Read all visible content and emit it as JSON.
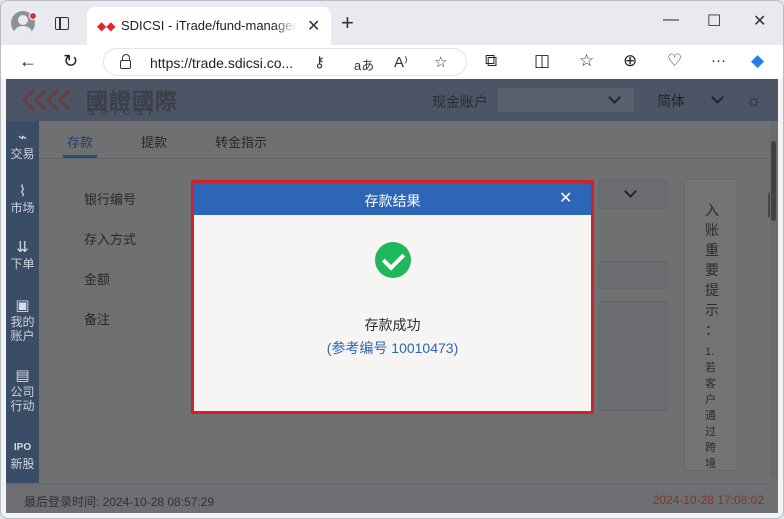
{
  "browser": {
    "tab_title": "SDICSI - iTrade/fund-management",
    "url": "https://trade.sdicsi.co...",
    "new_tab_glyph": "+",
    "close_glyph": "✕",
    "minimize_glyph": "—",
    "maximize_glyph": "☐",
    "window_close_glyph": "✕",
    "back_glyph": "←",
    "refresh_glyph": "↻",
    "more_glyph": "···"
  },
  "app": {
    "logo_cn": "國證國際",
    "logo_en": "SDICSI",
    "account_label": "现金账户",
    "account_value": "",
    "language": "简体",
    "sidebar": [
      {
        "icon": "trade-icon",
        "glyph": "⌁",
        "label": "交易"
      },
      {
        "icon": "market-icon",
        "glyph": "📈",
        "label": "市场"
      },
      {
        "icon": "order-icon",
        "glyph": "⇊",
        "label": "下单"
      },
      {
        "icon": "wallet-icon",
        "glyph": "▣",
        "label": "我的账户"
      },
      {
        "icon": "building-icon",
        "glyph": "▤",
        "label": "公司行动"
      },
      {
        "icon": "ipo-icon",
        "glyph": "IPO",
        "label": "新股"
      }
    ],
    "tabs": [
      "存款",
      "提款",
      "转金指示"
    ],
    "form": {
      "bank_code_label": "银行编号",
      "deposit_method_label": "存入方式",
      "amount_label": "金额",
      "remark_label": "备注"
    },
    "notice": {
      "title_chars": [
        "入",
        "账",
        "重",
        "要",
        "提",
        "示",
        "："
      ],
      "body_chars": [
        "1.",
        "若",
        "客",
        "户",
        "通",
        "过",
        "跨",
        "境"
      ]
    },
    "footer": {
      "last_login": "最后登录时间: 2024-10-28 08:57:29",
      "clock": "2024-10-28 17:08:02"
    }
  },
  "modal": {
    "title": "存款结果",
    "close": "✕",
    "message": "存款成功",
    "reference": "(参考编号 10010473)"
  },
  "colors": {
    "modal_header": "#2d66b6",
    "success": "#1fb85c",
    "highlight_border": "#d4202a"
  }
}
